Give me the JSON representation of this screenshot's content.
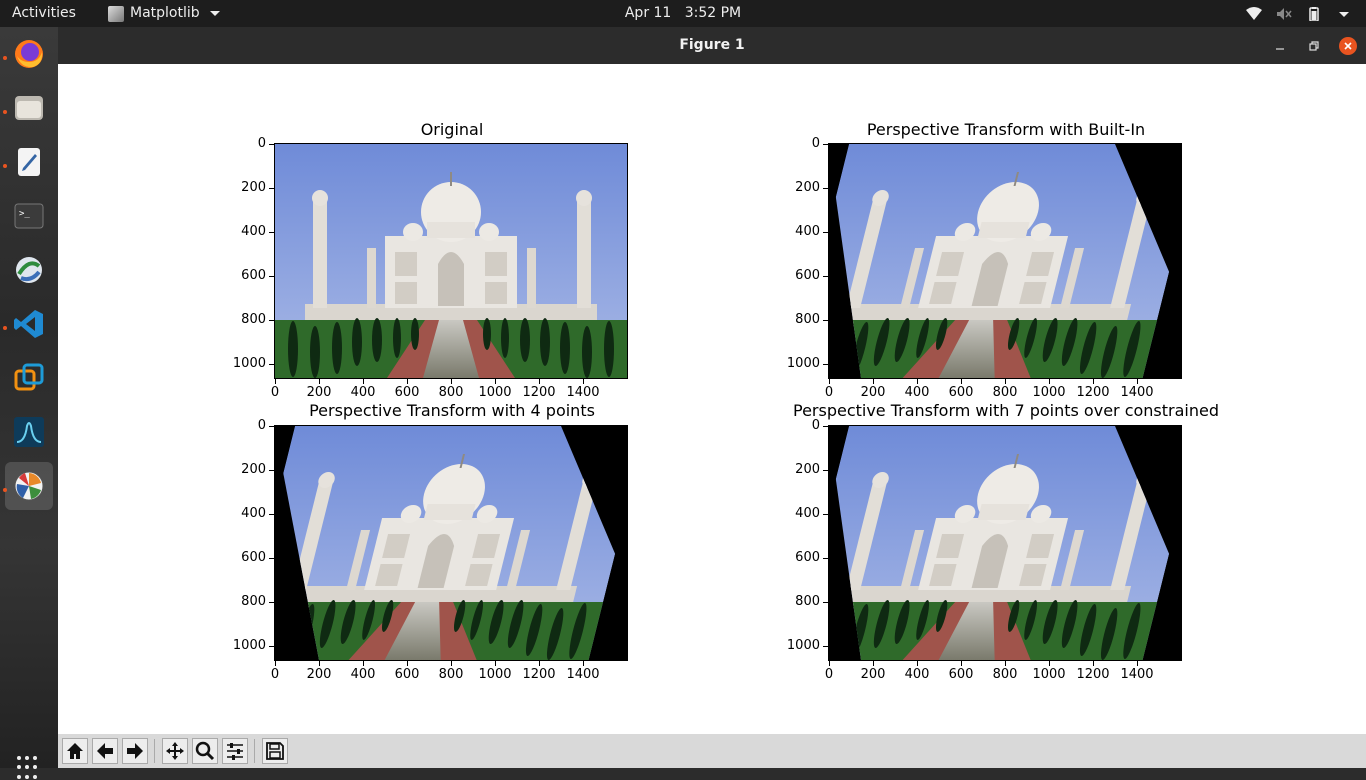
{
  "topbar": {
    "activities": "Activities",
    "app_name": "Matplotlib",
    "date": "Apr 11",
    "time": "3:52 PM"
  },
  "dock": {
    "apps": [
      {
        "name": "Firefox",
        "icon": "firefox-icon"
      },
      {
        "name": "Files",
        "icon": "files-icon"
      },
      {
        "name": "Text Editor",
        "icon": "text-editor-icon"
      },
      {
        "name": "Terminal",
        "icon": "terminal-icon"
      },
      {
        "name": "Software",
        "icon": "software-icon"
      },
      {
        "name": "VS Code",
        "icon": "vscode-icon"
      },
      {
        "name": "VMware",
        "icon": "vmware-icon"
      },
      {
        "name": "MATLAB",
        "icon": "matlab-icon"
      },
      {
        "name": "Matplotlib",
        "icon": "matplotlib-icon"
      }
    ]
  },
  "window": {
    "title": "Figure 1",
    "min_label": "–",
    "max_label": "▫",
    "close_label": "✕"
  },
  "colors": {
    "accent": "#e95420",
    "sky": "#7b96dc",
    "marble": "#e8e4e0",
    "garden": "#2d6b27",
    "path": "#b0584e"
  },
  "subplots": [
    {
      "title": "Original",
      "image": "Taj Mahal photograph",
      "xticks": [
        "0",
        "200",
        "400",
        "600",
        "800",
        "1000",
        "1200",
        "1400"
      ],
      "yticks": [
        "0",
        "200",
        "400",
        "600",
        "800",
        "1000"
      ],
      "transform": "none"
    },
    {
      "title": "Perspective Transform with Built-In",
      "image": "Taj Mahal photograph, perspective warped",
      "xticks": [
        "0",
        "200",
        "400",
        "600",
        "800",
        "1000",
        "1200",
        "1400"
      ],
      "yticks": [
        "0",
        "200",
        "400",
        "600",
        "800",
        "1000"
      ],
      "transform": "warp"
    },
    {
      "title": "Perspective Transform with 4 points",
      "image": "Taj Mahal photograph, perspective warped",
      "xticks": [
        "0",
        "200",
        "400",
        "600",
        "800",
        "1000",
        "1200",
        "1400"
      ],
      "yticks": [
        "0",
        "200",
        "400",
        "600",
        "800",
        "1000"
      ],
      "transform": "warp"
    },
    {
      "title": "Perspective Transform with 7 points over constrained",
      "image": "Taj Mahal photograph, perspective warped",
      "xticks": [
        "0",
        "200",
        "400",
        "600",
        "800",
        "1000",
        "1200",
        "1400"
      ],
      "yticks": [
        "0",
        "200",
        "400",
        "600",
        "800",
        "1000"
      ],
      "transform": "warp"
    }
  ],
  "toolbar": {
    "buttons": [
      {
        "name": "home",
        "icon": "home-icon"
      },
      {
        "name": "back",
        "icon": "back-arrow-icon"
      },
      {
        "name": "forward",
        "icon": "forward-arrow-icon"
      },
      {
        "name": "pan",
        "icon": "pan-icon"
      },
      {
        "name": "zoom",
        "icon": "zoom-icon"
      },
      {
        "name": "configure",
        "icon": "sliders-icon"
      },
      {
        "name": "save",
        "icon": "save-icon"
      }
    ]
  }
}
